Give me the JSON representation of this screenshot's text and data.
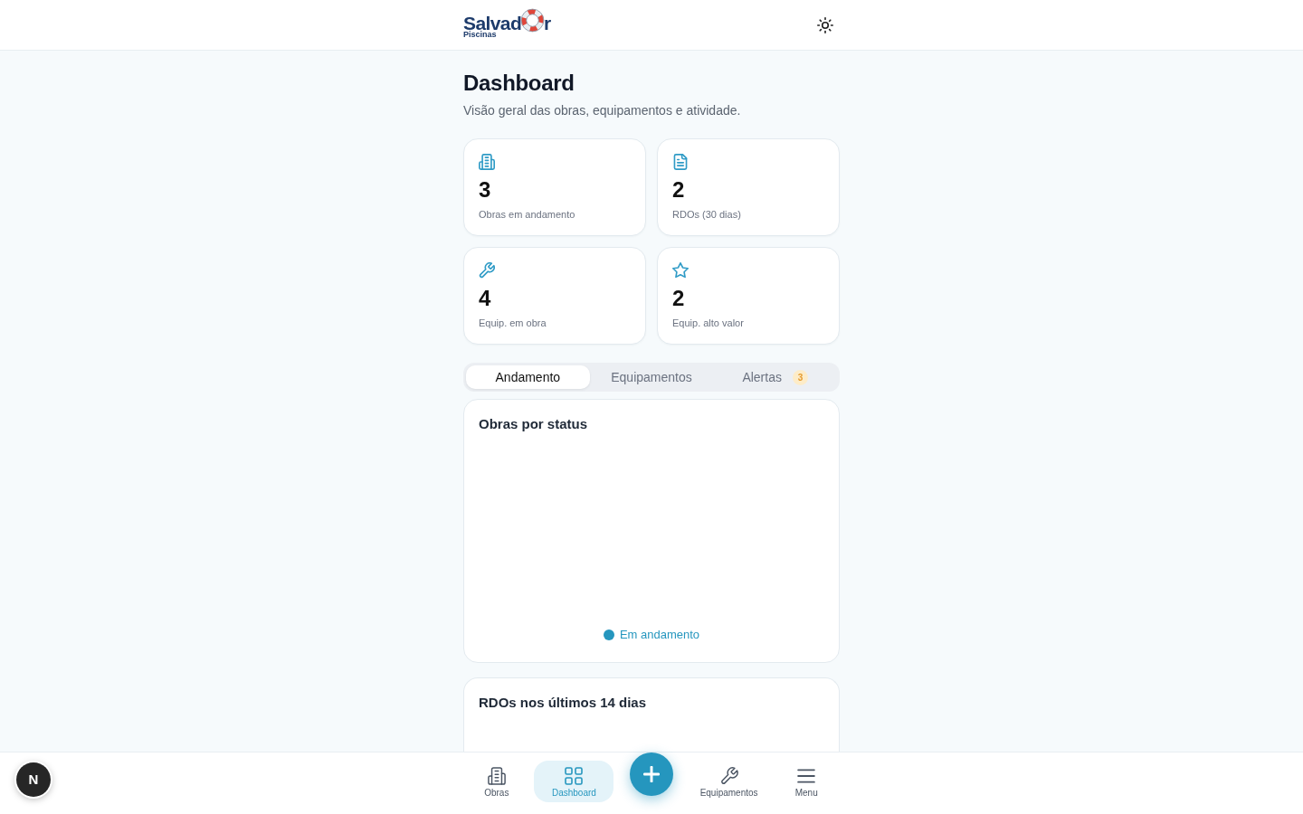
{
  "header": {
    "logo": {
      "text_start": "Salvad",
      "text_end": "r",
      "tagline": "Piscinas"
    }
  },
  "page": {
    "title": "Dashboard",
    "subtitle": "Visão geral das obras, equipamentos e atividade."
  },
  "stats": [
    {
      "kind": "building",
      "value": "3",
      "label": "Obras em andamento"
    },
    {
      "kind": "document",
      "value": "2",
      "label": "RDOs (30 dias)"
    },
    {
      "kind": "wrench",
      "value": "4",
      "label": "Equip. em obra"
    },
    {
      "kind": "star",
      "value": "2",
      "label": "Equip. alto valor"
    }
  ],
  "tabs": [
    {
      "label": "Andamento",
      "selected": true
    },
    {
      "label": "Equipamentos",
      "selected": false
    },
    {
      "label": "Alertas",
      "selected": false,
      "badge": "3"
    }
  ],
  "panels": [
    {
      "title": "Obras por status",
      "legend": [
        {
          "label": "Em andamento",
          "color": "#2596be"
        }
      ]
    },
    {
      "title": "RDOs nos últimos 14 dias"
    }
  ],
  "bottom_nav": [
    {
      "kind": "building",
      "label": "Obras",
      "selected": false
    },
    {
      "kind": "grid",
      "label": "Dashboard",
      "selected": true
    },
    {
      "kind": "add",
      "selected": false
    },
    {
      "kind": "wrench",
      "label": "Equipamentos",
      "selected": false
    },
    {
      "kind": "menu",
      "label": "Menu",
      "selected": false
    }
  ],
  "dev_badge": {
    "label": "N"
  }
}
